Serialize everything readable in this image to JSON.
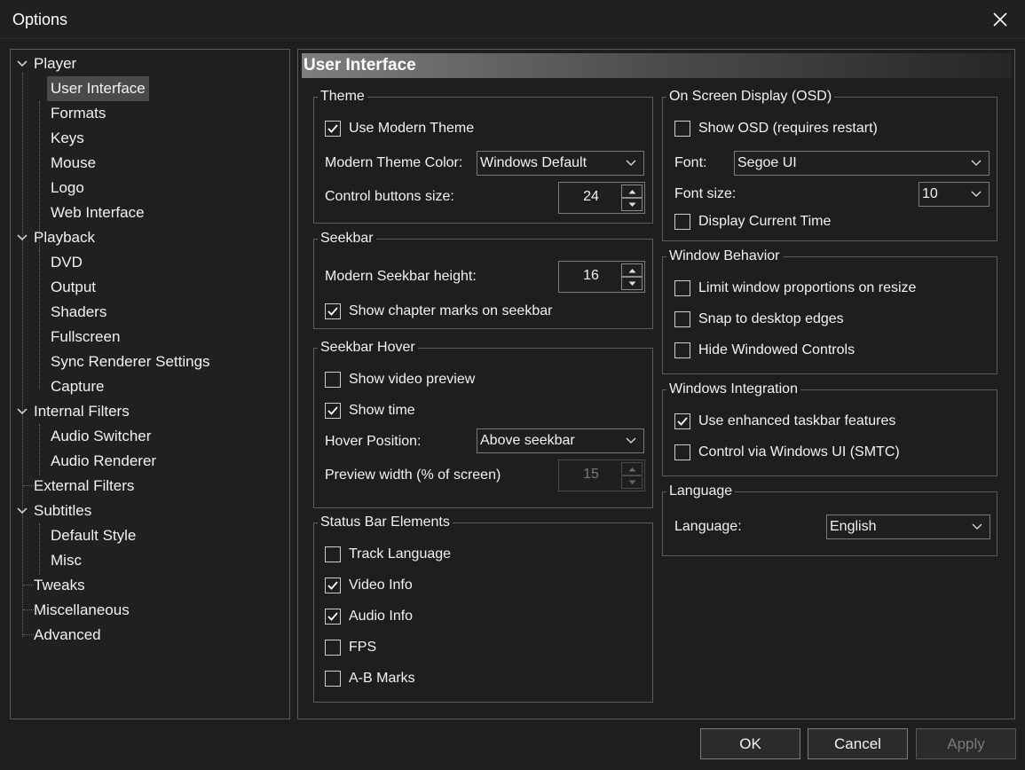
{
  "window": {
    "title": "Options"
  },
  "tree": {
    "items": [
      "Player",
      "User Interface",
      "Formats",
      "Keys",
      "Mouse",
      "Logo",
      "Web Interface",
      "Playback",
      "DVD",
      "Output",
      "Shaders",
      "Fullscreen",
      "Sync Renderer Settings",
      "Capture",
      "Internal Filters",
      "Audio Switcher",
      "Audio Renderer",
      "External Filters",
      "Subtitles",
      "Default Style",
      "Misc",
      "Tweaks",
      "Miscellaneous",
      "Advanced"
    ],
    "selected": "User Interface"
  },
  "page": {
    "header": "User Interface"
  },
  "theme": {
    "title": "Theme",
    "use_modern_theme": "Use Modern Theme",
    "use_modern_theme_checked": true,
    "color_label": "Modern Theme Color:",
    "color_value": "Windows Default",
    "buttons_size_label": "Control buttons size:",
    "buttons_size_value": "24"
  },
  "seekbar": {
    "title": "Seekbar",
    "height_label": "Modern Seekbar height:",
    "height_value": "16",
    "chapter_marks": "Show chapter marks on seekbar",
    "chapter_marks_checked": true
  },
  "seekbar_hover": {
    "title": "Seekbar Hover",
    "video_preview": "Show video preview",
    "video_preview_checked": false,
    "show_time": "Show time",
    "show_time_checked": true,
    "position_label": "Hover Position:",
    "position_value": "Above seekbar",
    "preview_width_label": "Preview width (% of screen)",
    "preview_width_value": "15"
  },
  "status_bar": {
    "title": "Status Bar Elements",
    "items": [
      {
        "label": "Track Language",
        "checked": false
      },
      {
        "label": "Video Info",
        "checked": true
      },
      {
        "label": "Audio Info",
        "checked": true
      },
      {
        "label": "FPS",
        "checked": false
      },
      {
        "label": "A-B Marks",
        "checked": false
      }
    ]
  },
  "osd": {
    "title": "On Screen Display (OSD)",
    "show_osd": "Show OSD (requires restart)",
    "show_osd_checked": false,
    "font_label": "Font:",
    "font_value": "Segoe UI",
    "font_size_label": "Font size:",
    "font_size_value": "10",
    "current_time": "Display Current Time",
    "current_time_checked": false
  },
  "window_behavior": {
    "title": "Window Behavior",
    "items": [
      {
        "label": "Limit window proportions on resize",
        "checked": false
      },
      {
        "label": "Snap to desktop edges",
        "checked": false
      },
      {
        "label": "Hide Windowed Controls",
        "checked": false
      }
    ]
  },
  "windows_integration": {
    "title": "Windows Integration",
    "items": [
      {
        "label": "Use enhanced taskbar features",
        "checked": true
      },
      {
        "label": "Control via Windows UI (SMTC)",
        "checked": false
      }
    ]
  },
  "language": {
    "title": "Language",
    "label": "Language:",
    "value": "English"
  },
  "buttons": {
    "ok": "OK",
    "cancel": "Cancel",
    "apply": "Apply"
  }
}
